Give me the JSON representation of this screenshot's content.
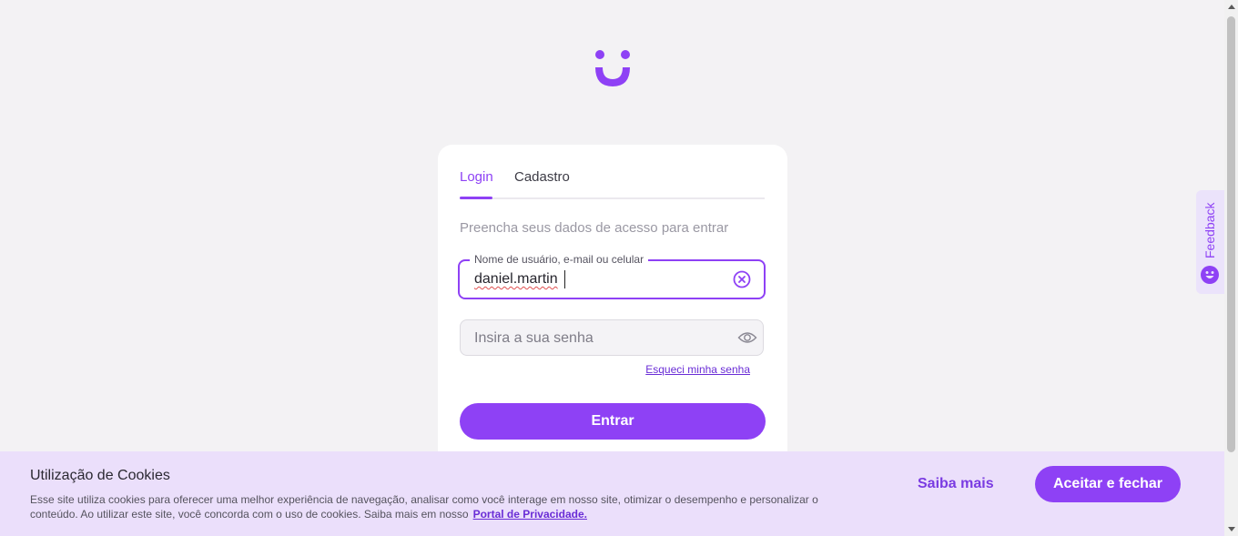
{
  "brand": {
    "logo_icon": "smile-logo-icon",
    "accent_color": "#8e41f5"
  },
  "auth_card": {
    "tabs": [
      {
        "label": "Login",
        "active": true
      },
      {
        "label": "Cadastro",
        "active": false
      }
    ],
    "subtitle": "Preencha seus dados de acesso para entrar",
    "username_field": {
      "label": "Nome de usuário, e-mail ou celular",
      "value": "daniel.martin",
      "clear_icon": "clear-circle-icon"
    },
    "password_field": {
      "placeholder": "Insira a sua senha",
      "toggle_icon": "eye-icon"
    },
    "forgot_link": "Esqueci minha senha",
    "submit_label": "Entrar"
  },
  "feedback": {
    "label": "Feedback",
    "icon": "smile-icon"
  },
  "cookie_banner": {
    "title": "Utilização de Cookies",
    "text": "Esse site utiliza cookies para oferecer uma melhor experiência de navegação, analisar como você interage em nosso site, otimizar o desempenho e personalizar o conteúdo. Ao utilizar este site, você concorda com o uso de cookies. Saiba mais em nosso",
    "link_label": "Portal de Privacidade.",
    "saiba_mais_label": "Saiba mais",
    "accept_label": "Aceitar e fechar"
  }
}
